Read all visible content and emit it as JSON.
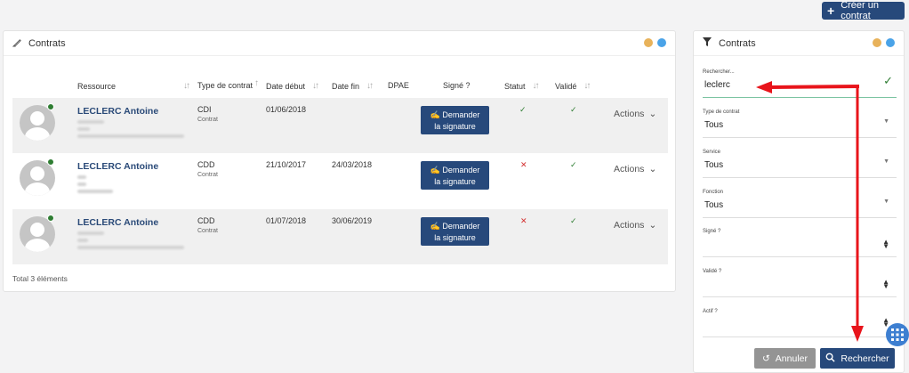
{
  "toolbar": {
    "create_label": "Créer un contrat",
    "create_icon": "plus-icon"
  },
  "contracts_panel": {
    "title": "Contrats",
    "dot_colors": [
      "#e8b25a",
      "#4aa3e8"
    ],
    "columns": [
      "Ressource",
      "Type de contrat",
      "Date début",
      "Date fin",
      "DPAE",
      "Signé ?",
      "Statut",
      "Validé"
    ],
    "rows": [
      {
        "name": "LECLERC Antoine",
        "type": "CDI",
        "subtype": "Contrat",
        "start": "01/06/2018",
        "end": "",
        "sign_label_1": "Demander",
        "sign_label_2": "la signature",
        "statut": "✓",
        "valide": "✓",
        "actions": "Actions"
      },
      {
        "name": "LECLERC Antoine",
        "type": "CDD",
        "subtype": "Contrat",
        "start": "21/10/2017",
        "end": "24/03/2018",
        "sign_label_1": "Demander",
        "sign_label_2": "la signature",
        "statut": "✕",
        "valide": "✓",
        "actions": "Actions"
      },
      {
        "name": "LECLERC Antoine",
        "type": "CDD",
        "subtype": "Contrat",
        "start": "01/07/2018",
        "end": "30/06/2019",
        "sign_label_1": "Demander",
        "sign_label_2": "la signature",
        "statut": "✕",
        "valide": "✓",
        "actions": "Actions"
      }
    ],
    "total": "Total 3 éléments"
  },
  "filter_panel": {
    "title": "Contrats",
    "search_label": "Rechercher...",
    "search_value": "leclerc",
    "type_label": "Type de contrat",
    "type_value": "Tous",
    "service_label": "Service",
    "service_value": "Tous",
    "fonction_label": "Fonction",
    "fonction_value": "Tous",
    "signe_label": "Signé ?",
    "valide_label": "Validé ?",
    "actif_label": "Actif ?",
    "cancel_label": "Annuler",
    "search_button_label": "Rechercher"
  },
  "accent_color": "#27497b",
  "annotation_color": "#e8141b"
}
